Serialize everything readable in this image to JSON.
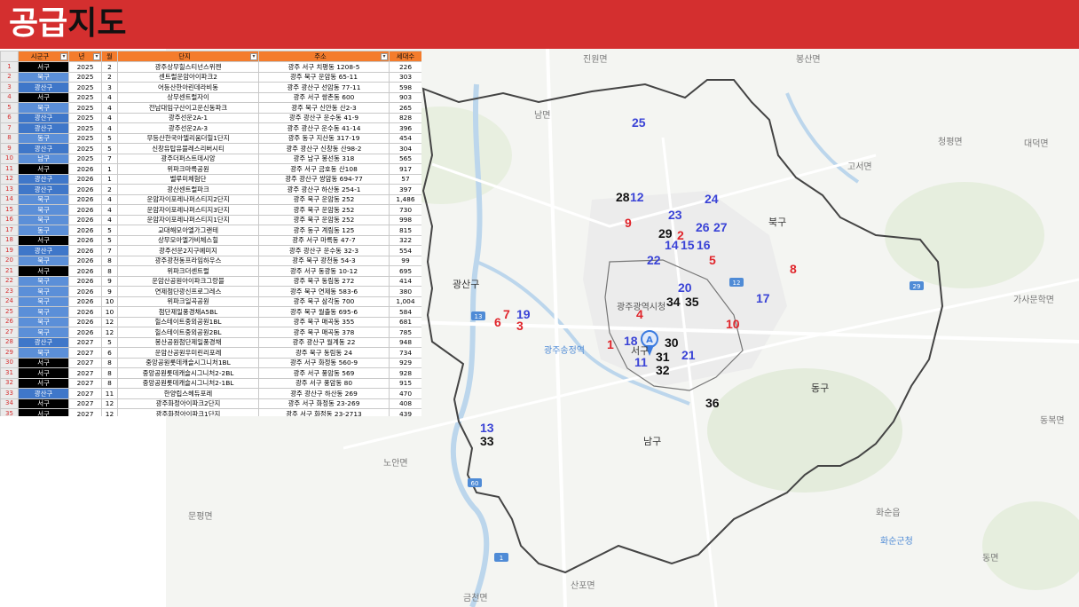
{
  "page_title_part1": "공급",
  "page_title_part2": "지도",
  "table": {
    "headers": [
      "시군구",
      "년",
      "월",
      "단지",
      "주소",
      "세대수"
    ],
    "rows": [
      {
        "idx": "1",
        "gu": "서구",
        "year": "2025",
        "month": "2",
        "name": "광주상무힐스티넌스위젠",
        "addr": "광주 서구 치평동 1208-5",
        "units": "226"
      },
      {
        "idx": "2",
        "gu": "북구",
        "year": "2025",
        "month": "2",
        "name": "센트럴운암아이파크2",
        "addr": "광주 북구 운암동 65-11",
        "units": "303"
      },
      {
        "idx": "3",
        "gu": "광산구",
        "year": "2025",
        "month": "3",
        "name": "어등산한아린데라비동",
        "addr": "광주 광산구 선암동 77-11",
        "units": "598"
      },
      {
        "idx": "4",
        "gu": "서구",
        "year": "2025",
        "month": "4",
        "name": "상무센트럴자이",
        "addr": "광주 서구 쌍촌동 600",
        "units": "903"
      },
      {
        "idx": "5",
        "gu": "북구",
        "year": "2025",
        "month": "4",
        "name": "전남대임구산이고운신동파크",
        "addr": "광주 북구 신안동 산2-3",
        "units": "265"
      },
      {
        "idx": "6",
        "gu": "광산구",
        "year": "2025",
        "month": "4",
        "name": "광주선운2A-1",
        "addr": "광주 광산구 운수동 41-9",
        "units": "828"
      },
      {
        "idx": "7",
        "gu": "광산구",
        "year": "2025",
        "month": "4",
        "name": "광주선운2A-3",
        "addr": "광주 광산구 운수동 41-14",
        "units": "396"
      },
      {
        "idx": "8",
        "gu": "동구",
        "year": "2025",
        "month": "5",
        "name": "무등산한국아델리움더힐1단지",
        "addr": "광주 동구 지산동 317-19",
        "units": "454"
      },
      {
        "idx": "9",
        "gu": "광산구",
        "year": "2025",
        "month": "5",
        "name": "신창유탑유블레스리버시티",
        "addr": "광주 광산구 신창동 산98-2",
        "units": "304"
      },
      {
        "idx": "10",
        "gu": "남구",
        "year": "2025",
        "month": "7",
        "name": "광주더퍼스트데시앙",
        "addr": "광주 남구 봉선동 318",
        "units": "565"
      },
      {
        "idx": "11",
        "gu": "서구",
        "year": "2026",
        "month": "1",
        "name": "위파크마륵공원",
        "addr": "광주 서구 금호동 산108",
        "units": "917"
      },
      {
        "idx": "12",
        "gu": "광산구",
        "year": "2026",
        "month": "1",
        "name": "벨루미체험단",
        "addr": "광주 광산구 쌍암동 694-77",
        "units": "57"
      },
      {
        "idx": "13",
        "gu": "광산구",
        "year": "2026",
        "month": "2",
        "name": "광산센트럴파크",
        "addr": "광주 광산구 하산동 254-1",
        "units": "397"
      },
      {
        "idx": "14",
        "gu": "북구",
        "year": "2026",
        "month": "4",
        "name": "운암자이포레나퍼스티지2단지",
        "addr": "광주 북구 운암동 252",
        "units": "1,486"
      },
      {
        "idx": "15",
        "gu": "북구",
        "year": "2026",
        "month": "4",
        "name": "운암자이포레나퍼스티지3단지",
        "addr": "광주 북구 운암동 252",
        "units": "730"
      },
      {
        "idx": "16",
        "gu": "북구",
        "year": "2026",
        "month": "4",
        "name": "운암자이포레나퍼스티지1단지",
        "addr": "광주 북구 운암동 252",
        "units": "998"
      },
      {
        "idx": "17",
        "gu": "동구",
        "year": "2026",
        "month": "5",
        "name": "교대해모아엘가그랜테",
        "addr": "광주 동구 계림동 125",
        "units": "815"
      },
      {
        "idx": "18",
        "gu": "서구",
        "year": "2026",
        "month": "5",
        "name": "상무모아엘가비체스힐",
        "addr": "광주 서구 마륵동 47-7",
        "units": "322"
      },
      {
        "idx": "19",
        "gu": "광산구",
        "year": "2026",
        "month": "7",
        "name": "광주선운2지구예미지",
        "addr": "광주 광산구 운수동 32-3",
        "units": "554"
      },
      {
        "idx": "20",
        "gu": "북구",
        "year": "2026",
        "month": "8",
        "name": "광주광천동프라임하우스",
        "addr": "광주 북구 광천동 54-3",
        "units": "99"
      },
      {
        "idx": "21",
        "gu": "서구",
        "year": "2026",
        "month": "8",
        "name": "위파크더센트럴",
        "addr": "광주 서구 동광동 10-12",
        "units": "695"
      },
      {
        "idx": "22",
        "gu": "북구",
        "year": "2026",
        "month": "9",
        "name": "운암산공원아이파크그랑블",
        "addr": "광주 북구 동림동 272",
        "units": "414"
      },
      {
        "idx": "23",
        "gu": "북구",
        "year": "2026",
        "month": "9",
        "name": "연제첨단광신프로그레스",
        "addr": "광주 북구 연제동 583-6",
        "units": "380"
      },
      {
        "idx": "24",
        "gu": "북구",
        "year": "2026",
        "month": "10",
        "name": "위파크일곡공원",
        "addr": "광주 북구 삼각동 700",
        "units": "1,004"
      },
      {
        "idx": "25",
        "gu": "북구",
        "year": "2026",
        "month": "10",
        "name": "첨단제일풍경채A5BL",
        "addr": "광주 북구 월출동 695-6",
        "units": "584"
      },
      {
        "idx": "26",
        "gu": "북구",
        "year": "2026",
        "month": "12",
        "name": "힐스테이트중외공원1BL",
        "addr": "광주 북구 매곡동 355",
        "units": "681"
      },
      {
        "idx": "27",
        "gu": "북구",
        "year": "2026",
        "month": "12",
        "name": "힐스테이트중외공원2BL",
        "addr": "광주 북구 매곡동 378",
        "units": "785"
      },
      {
        "idx": "28",
        "gu": "광산구",
        "year": "2027",
        "month": "5",
        "name": "봉산공원첨단제일풍경채",
        "addr": "광주 광산구 월계동 22",
        "units": "948"
      },
      {
        "idx": "29",
        "gu": "북구",
        "year": "2027",
        "month": "6",
        "name": "운암산공원우미린리포레",
        "addr": "광주 북구 동림동 24",
        "units": "734"
      },
      {
        "idx": "30",
        "gu": "서구",
        "year": "2027",
        "month": "8",
        "name": "중앙공원롯데캐슬시그니처1BL",
        "addr": "광주 서구 화정동 560-9",
        "units": "929"
      },
      {
        "idx": "31",
        "gu": "서구",
        "year": "2027",
        "month": "8",
        "name": "중앙공원롯데캐슬시그니처2-2BL",
        "addr": "광주 서구 풍암동 569",
        "units": "928"
      },
      {
        "idx": "32",
        "gu": "서구",
        "year": "2027",
        "month": "8",
        "name": "중앙공원롯데캐슬시그니처2-1BL",
        "addr": "광주 서구 풍암동 80",
        "units": "915"
      },
      {
        "idx": "33",
        "gu": "광산구",
        "year": "2027",
        "month": "11",
        "name": "한양립스헤듀포레",
        "addr": "광주 광산구 하산동 269",
        "units": "470"
      },
      {
        "idx": "34",
        "gu": "서구",
        "year": "2027",
        "month": "12",
        "name": "광주화정아이파크2단지",
        "addr": "광주 서구 화정동 23-269",
        "units": "408"
      },
      {
        "idx": "35",
        "gu": "서구",
        "year": "2027",
        "month": "12",
        "name": "광주화정아이파크1단지",
        "addr": "광주 서구 화정동 23-2713",
        "units": "439"
      },
      {
        "idx": "36",
        "gu": "남구",
        "year": "2027",
        "month": "12",
        "name": "광주송암공원중흥S클래스SK뷰",
        "addr": "광주 남구 송하동 16-1",
        "units": "1,575"
      }
    ]
  },
  "map": {
    "place_labels": {
      "jinwon": "진원면",
      "bongsan": "봉산면",
      "nam": "남면",
      "daedeok": "대덕면",
      "gaseo": "고서면",
      "cheongpyeong": "청평면",
      "gasa": "가사문학면",
      "gwangsan_city": "광주광역시청",
      "gwangju_stn": "광주송정역",
      "nopyeong": "노안면",
      "munpyeong": "문평면",
      "hwasun": "화순읍",
      "hwasun_gun": "화순군청",
      "dong": "동면",
      "sanpo": "산포면",
      "geumcheon": "금천면",
      "dongbok": "동복면"
    },
    "district_labels": {
      "gwangsan": "광산구",
      "buk": "북구",
      "dong": "동구",
      "nam": "남구",
      "seo": "서구"
    },
    "markers": [
      {
        "id": "m25",
        "label": "25",
        "color": "blue"
      },
      {
        "id": "m28",
        "label": "28",
        "color": "black"
      },
      {
        "id": "m12",
        "label": "12",
        "color": "blue"
      },
      {
        "id": "m24",
        "label": "24",
        "color": "blue"
      },
      {
        "id": "m23",
        "label": "23",
        "color": "blue"
      },
      {
        "id": "m9",
        "label": "9",
        "color": "red"
      },
      {
        "id": "m29",
        "label": "29",
        "color": "black"
      },
      {
        "id": "m2",
        "label": "2",
        "color": "red"
      },
      {
        "id": "m26",
        "label": "26",
        "color": "blue"
      },
      {
        "id": "m27",
        "label": "27",
        "color": "blue"
      },
      {
        "id": "m14",
        "label": "14",
        "color": "blue"
      },
      {
        "id": "m15",
        "label": "15",
        "color": "blue"
      },
      {
        "id": "m16",
        "label": "16",
        "color": "blue"
      },
      {
        "id": "m22",
        "label": "22",
        "color": "blue"
      },
      {
        "id": "m5",
        "label": "5",
        "color": "red"
      },
      {
        "id": "m8",
        "label": "8",
        "color": "red"
      },
      {
        "id": "m20",
        "label": "20",
        "color": "blue"
      },
      {
        "id": "m34",
        "label": "34",
        "color": "black"
      },
      {
        "id": "m35",
        "label": "35",
        "color": "black"
      },
      {
        "id": "m17",
        "label": "17",
        "color": "blue"
      },
      {
        "id": "m4",
        "label": "4",
        "color": "red"
      },
      {
        "id": "m6",
        "label": "6",
        "color": "red"
      },
      {
        "id": "m7",
        "label": "7",
        "color": "red"
      },
      {
        "id": "m19",
        "label": "19",
        "color": "blue"
      },
      {
        "id": "m3",
        "label": "3",
        "color": "red"
      },
      {
        "id": "m10",
        "label": "10",
        "color": "red"
      },
      {
        "id": "m1",
        "label": "1",
        "color": "red"
      },
      {
        "id": "m18",
        "label": "18",
        "color": "blue"
      },
      {
        "id": "m30",
        "label": "30",
        "color": "black"
      },
      {
        "id": "m31",
        "label": "31",
        "color": "black"
      },
      {
        "id": "m21",
        "label": "21",
        "color": "blue"
      },
      {
        "id": "m11",
        "label": "11",
        "color": "blue"
      },
      {
        "id": "m32",
        "label": "32",
        "color": "black"
      },
      {
        "id": "m36",
        "label": "36",
        "color": "black"
      },
      {
        "id": "m13",
        "label": "13",
        "color": "blue"
      },
      {
        "id": "m33",
        "label": "33",
        "color": "black"
      }
    ],
    "pin_label": "A",
    "road_numbers": {
      "r13": "13",
      "r60": "60",
      "r29": "29",
      "r12": "12",
      "r1": "1",
      "r45": "45",
      "r15": "15"
    }
  }
}
